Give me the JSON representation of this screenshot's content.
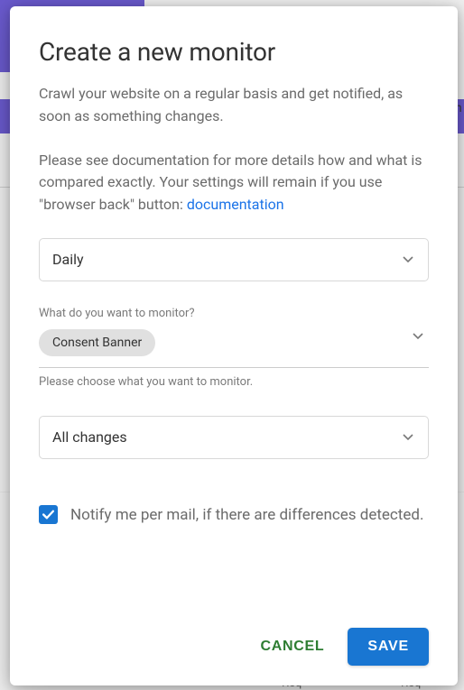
{
  "bg": {
    "right_text": "gin",
    "req": "Req"
  },
  "modal": {
    "title": "Create a new monitor",
    "intro1": "Crawl your website on a regular basis and get notified, as soon as something changes.",
    "intro2_prefix": "Please see documentation for more details how and what is compared exactly. Your settings will remain if you use \"browser back\" button: ",
    "intro2_link": "documentation",
    "frequency": {
      "selected": "Daily"
    },
    "monitor_target": {
      "label": "What do you want to monitor?",
      "chip": "Consent Banner",
      "helper": "Please choose what you want to monitor."
    },
    "change_scope": {
      "selected": "All changes"
    },
    "notify": {
      "label": "Notify me per mail, if there are differences detected.",
      "checked": true
    },
    "buttons": {
      "cancel": "CANCEL",
      "save": "SAVE"
    }
  }
}
